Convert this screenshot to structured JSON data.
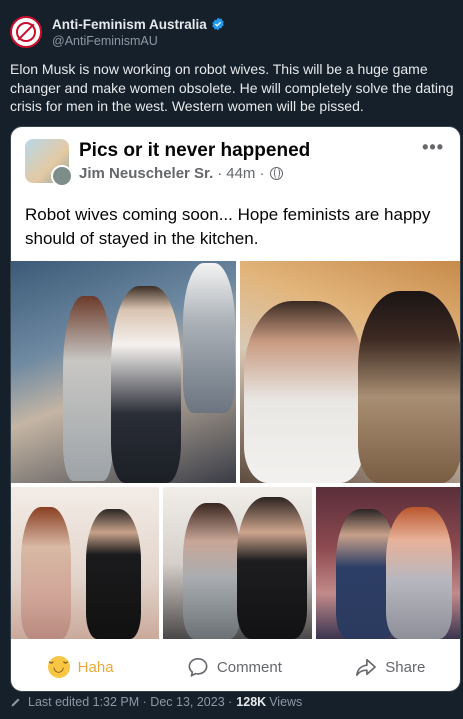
{
  "account": {
    "display_name": "Anti-Feminism Australia",
    "handle": "@AntiFeminismAU",
    "verified": true
  },
  "tweet": {
    "text": "Elon Musk is now working on robot wives. This will be a huge game changer and make women obsolete. He will completely solve the dating crisis for men in the west. Western women will be pissed."
  },
  "fb_post": {
    "group_name": "Pics or it never happened",
    "poster": "Jim Neuscheler Sr.",
    "time": "44m",
    "separator": "·",
    "text": "Robot wives coming soon... Hope feminists are happy should of stayed in the kitchen.",
    "actions": {
      "haha": "Haha",
      "comment": "Comment",
      "share": "Share"
    }
  },
  "footer": {
    "edited": "Last edited 1:32 PM · Dec 13, 2023 ·",
    "views_count": "128K",
    "views_label": "Views"
  },
  "colors": {
    "background": "#15202b",
    "verified": "#1d9bf0",
    "haha": "#e9a93a"
  }
}
